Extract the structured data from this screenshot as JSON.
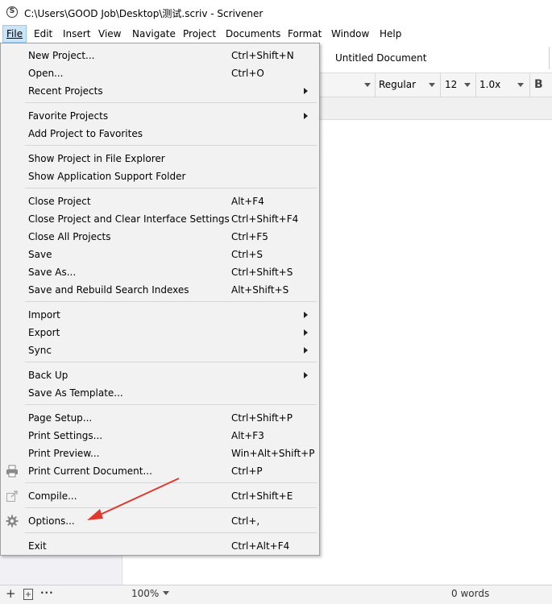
{
  "window": {
    "title": "C:\\Users\\GOOD Job\\Desktop\\测试.scriv - Scrivener",
    "app_logo": "S"
  },
  "menubar": [
    "File",
    "Edit",
    "Insert",
    "View",
    "Navigate",
    "Project",
    "Documents",
    "Format",
    "Window",
    "Help"
  ],
  "editor": {
    "doc_title": "Untitled Document",
    "font_style": "Regular",
    "font_size": "12",
    "line_spacing": "1.0x",
    "bold_label": "B"
  },
  "file_menu": [
    {
      "label": "New Project...",
      "shortcut": "Ctrl+Shift+N"
    },
    {
      "label": "Open...",
      "shortcut": "Ctrl+O"
    },
    {
      "label": "Recent Projects",
      "shortcut": "",
      "submenu": true
    },
    {
      "label": "Favorite Projects",
      "shortcut": "",
      "submenu": true
    },
    {
      "label": "Add Project to Favorites",
      "shortcut": ""
    },
    {
      "label": "Show Project in File Explorer",
      "shortcut": ""
    },
    {
      "label": "Show Application Support Folder",
      "shortcut": ""
    },
    {
      "label": "Close Project",
      "shortcut": "Alt+F4"
    },
    {
      "label": "Close Project and Clear Interface Settings",
      "shortcut": "Ctrl+Shift+F4"
    },
    {
      "label": "Close All Projects",
      "shortcut": "Ctrl+F5"
    },
    {
      "label": "Save",
      "shortcut": "Ctrl+S"
    },
    {
      "label": "Save As...",
      "shortcut": "Ctrl+Shift+S"
    },
    {
      "label": "Save and Rebuild Search Indexes",
      "shortcut": "Alt+Shift+S"
    },
    {
      "label": "Import",
      "shortcut": "",
      "submenu": true
    },
    {
      "label": "Export",
      "shortcut": "",
      "submenu": true
    },
    {
      "label": "Sync",
      "shortcut": "",
      "submenu": true
    },
    {
      "label": "Back Up",
      "shortcut": "",
      "submenu": true
    },
    {
      "label": "Save As Template...",
      "shortcut": ""
    },
    {
      "label": "Page Setup...",
      "shortcut": "Ctrl+Shift+P"
    },
    {
      "label": "Print Settings...",
      "shortcut": "Alt+F3"
    },
    {
      "label": "Print Preview...",
      "shortcut": "Win+Alt+Shift+P"
    },
    {
      "label": "Print Current Document...",
      "shortcut": "Ctrl+P",
      "icon": "printer-icon"
    },
    {
      "label": "Compile...",
      "shortcut": "Ctrl+Shift+E",
      "icon": "compile-icon"
    },
    {
      "label": "Options...",
      "shortcut": "Ctrl+,",
      "icon": "gear-icon"
    },
    {
      "label": "Exit",
      "shortcut": "Ctrl+Alt+F4"
    }
  ],
  "statusbar": {
    "zoom": "100%",
    "word_count": "0 words"
  },
  "colors": {
    "annotation_arrow": "#e03a2f",
    "menu_highlight": "#cce4f7"
  }
}
